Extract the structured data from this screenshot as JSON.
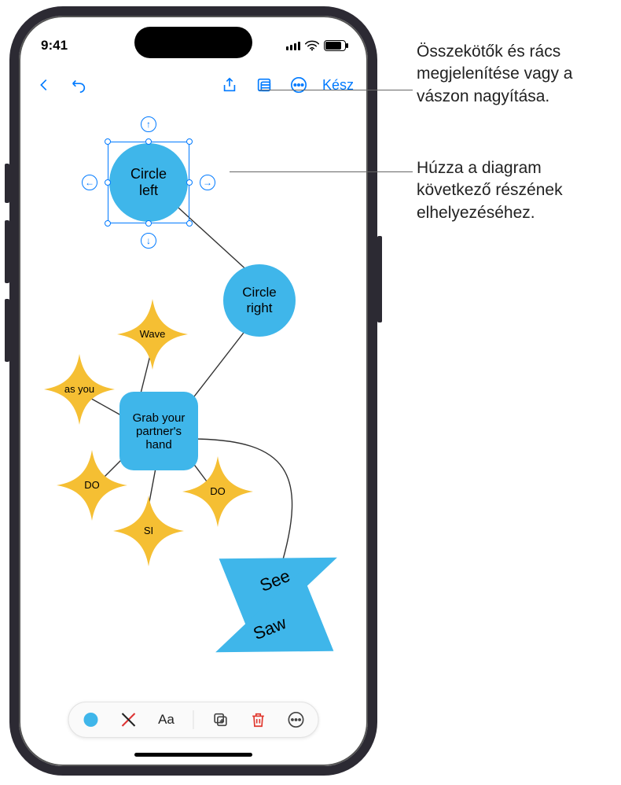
{
  "status": {
    "time": "9:41"
  },
  "toolbar": {
    "done_label": "Kész"
  },
  "shapes": {
    "circle_left": "Circle left",
    "circle_right": "Circle right",
    "wave": "Wave",
    "as_you": "as you",
    "grab": "Grab your partner's hand",
    "do1": "DO",
    "do2": "DO",
    "si": "SI",
    "see": "See",
    "saw": "Saw"
  },
  "bottom_bar": {
    "text_tool": "Aa"
  },
  "callouts": {
    "c1": "Összekötők és rács megjelenítése vagy a vászon nagyítása.",
    "c2": "Húzza a diagram következő részének elhelyezéséhez."
  }
}
